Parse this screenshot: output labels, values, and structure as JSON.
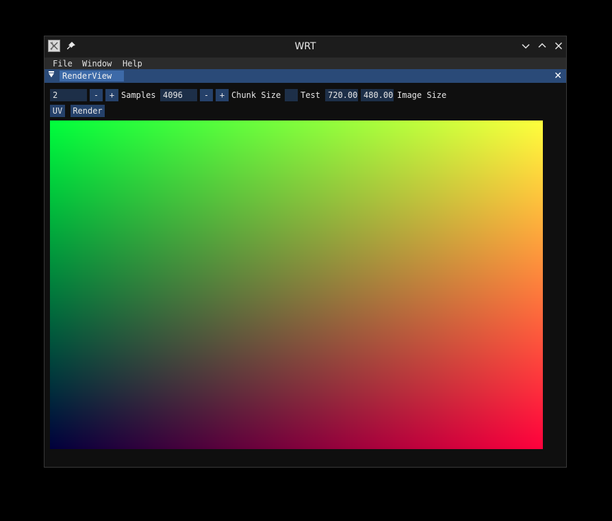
{
  "window": {
    "title": "WRT",
    "icons": {
      "app": "app-icon",
      "pin": "pin-icon",
      "minimize": "chevron-down-icon",
      "maximize": "chevron-up-icon",
      "close": "close-icon"
    }
  },
  "menubar": {
    "items": [
      "File",
      "Window",
      "Help"
    ]
  },
  "tab": {
    "label": "RenderView",
    "collapse_icon": "triangle-down-icon",
    "close_icon": "close-icon"
  },
  "controls": {
    "samples_value": "2",
    "samples_minus": "-",
    "samples_plus": "+",
    "samples_label": "Samples",
    "chunk_value": "4096",
    "chunk_minus": "-",
    "chunk_plus": "+",
    "chunk_label": "Chunk Size",
    "test_label": "Test",
    "width_value": "720.000",
    "height_value": "480.000",
    "image_size_label": "Image Size",
    "uv_button": "UV",
    "render_button": "Render"
  },
  "render_view": {
    "description_colors": {
      "top_left": "#00ff3c",
      "top_right": "#ffff3c",
      "bottom_left": "#00003c",
      "bottom_right": "#ff003c"
    }
  }
}
